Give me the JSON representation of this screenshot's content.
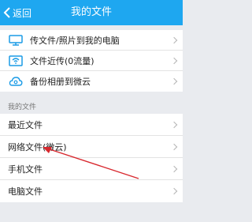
{
  "header": {
    "back_label": "返回",
    "title": "我的文件"
  },
  "top_items": [
    {
      "label": "传文件/照片到我的电脑",
      "icon": "monitor-icon"
    },
    {
      "label": "文件近传(0流量)",
      "icon": "wifi-box-icon"
    },
    {
      "label": "备份相册到微云",
      "icon": "cloud-icon"
    }
  ],
  "section_label": "我的文件",
  "file_items": [
    {
      "label": "最近文件"
    },
    {
      "label": "网络文件(微云)"
    },
    {
      "label": "手机文件"
    },
    {
      "label": "电脑文件"
    }
  ],
  "colors": {
    "header_bg": "#1ea7f0",
    "icon": "#1a9be6",
    "arrow": "#d8282e"
  }
}
